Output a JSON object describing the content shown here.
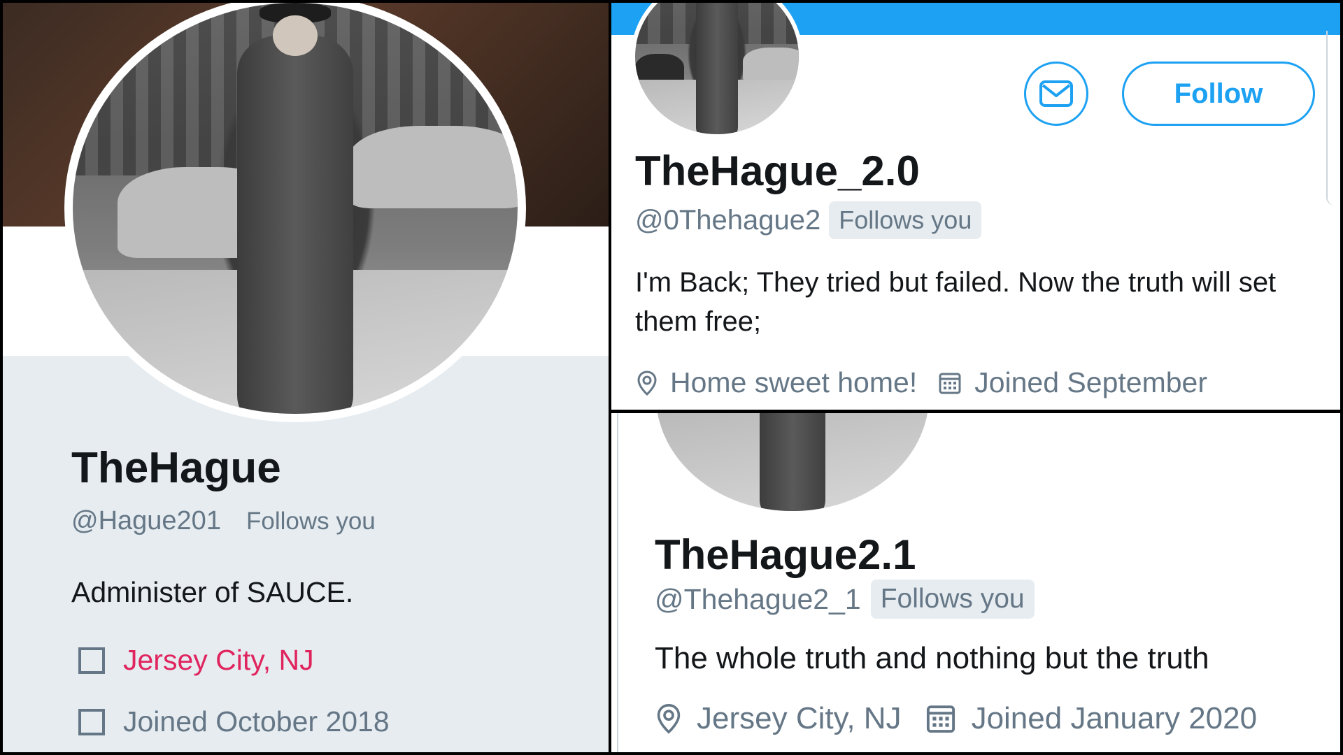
{
  "colors": {
    "twitter_blue": "#1da1f2",
    "secondary_text": "#657786",
    "primary_text": "#14171a",
    "link_red": "#e0245e",
    "panel_gray": "#e6ecf0"
  },
  "left_profile": {
    "name": "TheHague",
    "handle": "@Hague201",
    "follows_you": "Follows you",
    "bio": "Administer of SAUCE.",
    "location": "Jersey City, NJ",
    "joined": "Joined October 2018",
    "location_icon": "square-icon",
    "joined_icon": "square-icon"
  },
  "top_right_profile": {
    "name": "TheHague_2.0",
    "handle": "@0Thehague2",
    "follows_you": "Follows you",
    "bio": "I'm Back; They tried but failed.  Now the truth will set them free;",
    "location": "Home sweet home!",
    "joined": "Joined September",
    "follow_label": "Follow",
    "message_icon": "envelope-icon",
    "location_icon": "map-pin-icon",
    "joined_icon": "calendar-icon"
  },
  "bottom_right_profile": {
    "name": "TheHague2.1",
    "handle": "@Thehague2_1",
    "follows_you": "Follows you",
    "bio": "The whole truth and nothing but the truth",
    "location": "Jersey City, NJ",
    "joined": "Joined January 2020",
    "location_icon": "map-pin-icon",
    "joined_icon": "calendar-icon"
  }
}
